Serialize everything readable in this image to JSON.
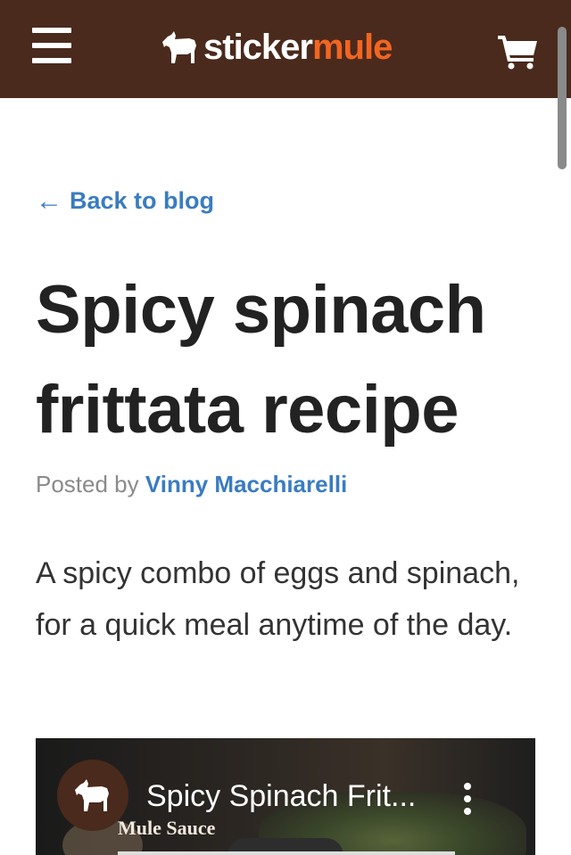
{
  "header": {
    "logo_left": "sticker",
    "logo_right": "mule",
    "colors": {
      "bar": "#4a2a1c",
      "accent": "#f26522"
    },
    "icons": [
      "menu-icon",
      "mule-logo-icon",
      "cart-icon"
    ]
  },
  "nav": {
    "back_arrow": "←",
    "back_label": "Back to blog"
  },
  "post": {
    "title": "Spicy spinach frittata recipe",
    "posted_by_label": "Posted by",
    "author": "Vinny Macchiarelli",
    "intro": "A spicy combo of eggs and spinach, for a quick meal anytime of the day."
  },
  "video": {
    "title": "Spicy Spinach Frit...",
    "channel_caption": "Mule Sauce"
  }
}
